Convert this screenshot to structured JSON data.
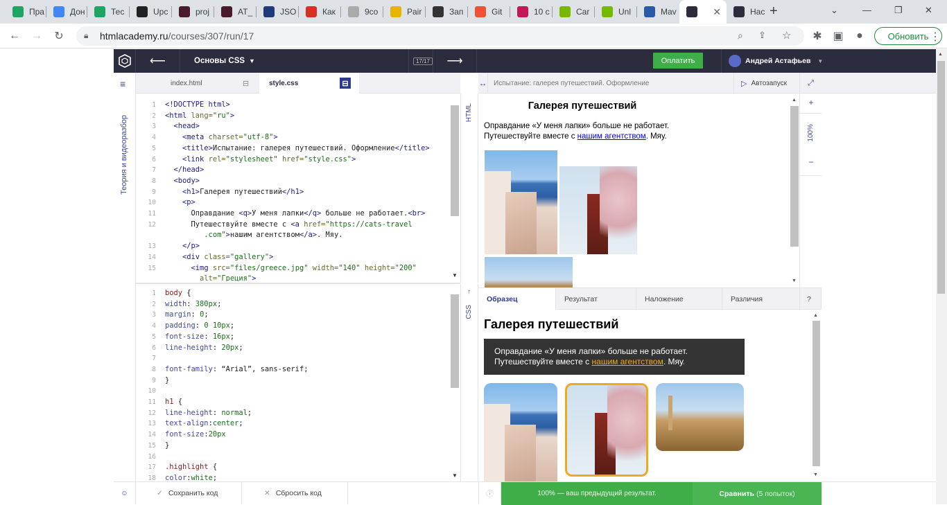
{
  "browser": {
    "tabs": [
      {
        "label": "Пра",
        "icon": "google-drive-icon"
      },
      {
        "label": "Дон",
        "icon": "google-docs-icon"
      },
      {
        "label": "Тес",
        "icon": "google-drive-icon"
      },
      {
        "label": "Upc",
        "icon": "upc-icon"
      },
      {
        "label": "proj",
        "icon": "yt-icon"
      },
      {
        "label": "AT_",
        "icon": "yt-icon"
      },
      {
        "label": "JSO",
        "icon": "json-icon"
      },
      {
        "label": "Как",
        "icon": "bookmark-icon"
      },
      {
        "label": "9co",
        "icon": "location-icon"
      },
      {
        "label": "Pair",
        "icon": "check-icon"
      },
      {
        "label": "Зап",
        "icon": "page-icon"
      },
      {
        "label": "Git",
        "icon": "git-icon"
      },
      {
        "label": "10 с",
        "icon": "v-icon"
      },
      {
        "label": "Car",
        "icon": "un-icon"
      },
      {
        "label": "Unl",
        "icon": "un-icon"
      },
      {
        "label": "Mav",
        "icon": "mvn-icon"
      },
      {
        "label": "",
        "icon": "htmlacademy-icon"
      },
      {
        "label": "Нас",
        "icon": "htmlacademy-icon"
      }
    ],
    "url_host": "htmlacademy.ru",
    "url_path": "/courses/307/run/17",
    "update_label": "Обновить"
  },
  "topbar": {
    "course": "Основы CSS",
    "progress": "17/17",
    "pay_label": "Оплатить",
    "user": "Андрей Астафьев"
  },
  "sidebar": {
    "label": "Теория и видеоразбор"
  },
  "editor": {
    "tab_html": "index.html",
    "tab_css": "style.css",
    "html_label": "HTML",
    "css_label": "CSS",
    "html_lines": [
      {
        "n": "1",
        "segs": [
          {
            "c": "tg",
            "t": "<!DOCTYPE html>"
          }
        ]
      },
      {
        "n": "2",
        "segs": [
          {
            "c": "tg",
            "t": "<html "
          },
          {
            "c": "at",
            "t": "lang="
          },
          {
            "c": "st",
            "t": "\"ru\""
          },
          {
            "c": "tg",
            "t": ">"
          }
        ]
      },
      {
        "n": "3",
        "segs": [
          {
            "c": "tx",
            "t": "  "
          },
          {
            "c": "tg",
            "t": "<head>"
          }
        ]
      },
      {
        "n": "4",
        "segs": [
          {
            "c": "tx",
            "t": "    "
          },
          {
            "c": "tg",
            "t": "<meta "
          },
          {
            "c": "at",
            "t": "charset="
          },
          {
            "c": "st",
            "t": "\"utf-8\""
          },
          {
            "c": "tg",
            "t": ">"
          }
        ]
      },
      {
        "n": "5",
        "segs": [
          {
            "c": "tx",
            "t": "    "
          },
          {
            "c": "tg",
            "t": "<title>"
          },
          {
            "c": "tx",
            "t": "Испытание: галерея путешествий. Оформление"
          },
          {
            "c": "tg",
            "t": "</title>"
          }
        ]
      },
      {
        "n": "6",
        "segs": [
          {
            "c": "tx",
            "t": "    "
          },
          {
            "c": "tg",
            "t": "<link "
          },
          {
            "c": "at",
            "t": "rel="
          },
          {
            "c": "st",
            "t": "\"stylesheet\" "
          },
          {
            "c": "at",
            "t": "href="
          },
          {
            "c": "st",
            "t": "\"style.css\""
          },
          {
            "c": "tg",
            "t": ">"
          }
        ]
      },
      {
        "n": "7",
        "segs": [
          {
            "c": "tx",
            "t": "  "
          },
          {
            "c": "tg",
            "t": "</head>"
          }
        ]
      },
      {
        "n": "8",
        "segs": [
          {
            "c": "tx",
            "t": "  "
          },
          {
            "c": "tg",
            "t": "<body>"
          }
        ]
      },
      {
        "n": "9",
        "segs": [
          {
            "c": "tx",
            "t": "    "
          },
          {
            "c": "tg",
            "t": "<h1>"
          },
          {
            "c": "tx",
            "t": "Галерея путешествий"
          },
          {
            "c": "tg",
            "t": "</h1>"
          }
        ]
      },
      {
        "n": "10",
        "segs": [
          {
            "c": "tx",
            "t": "    "
          },
          {
            "c": "tg",
            "t": "<p>"
          }
        ]
      },
      {
        "n": "11",
        "segs": [
          {
            "c": "tx",
            "t": "      Оправдание "
          },
          {
            "c": "tg",
            "t": "<q>"
          },
          {
            "c": "tx",
            "t": "У меня лапки"
          },
          {
            "c": "tg",
            "t": "</q>"
          },
          {
            "c": "tx",
            "t": " больше не работает."
          },
          {
            "c": "tg",
            "t": "<br>"
          }
        ]
      },
      {
        "n": "12",
        "segs": [
          {
            "c": "tx",
            "t": "      Путешествуйте вместе с "
          },
          {
            "c": "tg",
            "t": "<a "
          },
          {
            "c": "at",
            "t": "href="
          },
          {
            "c": "st",
            "t": "\"https://cats-travel"
          }
        ]
      },
      {
        "n": "",
        "segs": [
          {
            "c": "st",
            "t": "         .com\""
          },
          {
            "c": "tg",
            "t": ">"
          },
          {
            "c": "tx",
            "t": "нашим агентством"
          },
          {
            "c": "tg",
            "t": "</a>"
          },
          {
            "c": "tx",
            "t": ". Мяу."
          }
        ]
      },
      {
        "n": "13",
        "segs": [
          {
            "c": "tx",
            "t": "    "
          },
          {
            "c": "tg",
            "t": "</p>"
          }
        ]
      },
      {
        "n": "14",
        "segs": [
          {
            "c": "tx",
            "t": "    "
          },
          {
            "c": "tg",
            "t": "<div "
          },
          {
            "c": "at",
            "t": "class="
          },
          {
            "c": "st",
            "t": "\"gallery\""
          },
          {
            "c": "tg",
            "t": ">"
          }
        ]
      },
      {
        "n": "15",
        "segs": [
          {
            "c": "tx",
            "t": "      "
          },
          {
            "c": "tg",
            "t": "<img "
          },
          {
            "c": "at",
            "t": "src="
          },
          {
            "c": "st",
            "t": "\"files/greece.jpg\" "
          },
          {
            "c": "at",
            "t": "width="
          },
          {
            "c": "st",
            "t": "\"140\" "
          },
          {
            "c": "at",
            "t": "height="
          },
          {
            "c": "st",
            "t": "\"200\""
          }
        ]
      },
      {
        "n": "",
        "segs": [
          {
            "c": "tx",
            "t": "        "
          },
          {
            "c": "at",
            "t": "alt="
          },
          {
            "c": "st",
            "t": "\"Греция\""
          },
          {
            "c": "tg",
            "t": ">"
          }
        ]
      }
    ],
    "css_lines": [
      {
        "n": "1",
        "segs": [
          {
            "c": "sel",
            "t": "body"
          },
          {
            "c": "tx",
            "t": " {"
          }
        ]
      },
      {
        "n": "2",
        "segs": [
          {
            "c": "pr",
            "t": "width"
          },
          {
            "c": "tx",
            "t": ": "
          },
          {
            "c": "st",
            "t": "380px"
          },
          {
            "c": "tx",
            "t": ";"
          }
        ]
      },
      {
        "n": "3",
        "segs": [
          {
            "c": "pr",
            "t": "margin"
          },
          {
            "c": "tx",
            "t": ": "
          },
          {
            "c": "st",
            "t": "0"
          },
          {
            "c": "tx",
            "t": ";"
          }
        ]
      },
      {
        "n": "4",
        "segs": [
          {
            "c": "pr",
            "t": "padding"
          },
          {
            "c": "tx",
            "t": ": "
          },
          {
            "c": "st",
            "t": "0 10px"
          },
          {
            "c": "tx",
            "t": ";"
          }
        ]
      },
      {
        "n": "5",
        "segs": [
          {
            "c": "pr",
            "t": "font-size"
          },
          {
            "c": "tx",
            "t": ": "
          },
          {
            "c": "st",
            "t": "16px"
          },
          {
            "c": "tx",
            "t": ";"
          }
        ]
      },
      {
        "n": "6",
        "segs": [
          {
            "c": "pr",
            "t": "line-height"
          },
          {
            "c": "tx",
            "t": ": "
          },
          {
            "c": "st",
            "t": "20px"
          },
          {
            "c": "tx",
            "t": ";"
          }
        ]
      },
      {
        "n": "7",
        "segs": []
      },
      {
        "n": "8",
        "segs": [
          {
            "c": "pr",
            "t": "font-family"
          },
          {
            "c": "tx",
            "t": ": “Arial”, sans-serif;"
          }
        ]
      },
      {
        "n": "9",
        "segs": [
          {
            "c": "tx",
            "t": "}"
          }
        ]
      },
      {
        "n": "10",
        "segs": []
      },
      {
        "n": "11",
        "segs": [
          {
            "c": "sel",
            "t": "h1"
          },
          {
            "c": "tx",
            "t": " {"
          }
        ]
      },
      {
        "n": "12",
        "segs": [
          {
            "c": "pr",
            "t": "line-height"
          },
          {
            "c": "tx",
            "t": ": "
          },
          {
            "c": "st",
            "t": "normal"
          },
          {
            "c": "tx",
            "t": ";"
          }
        ]
      },
      {
        "n": "13",
        "segs": [
          {
            "c": "pr",
            "t": "text-align"
          },
          {
            "c": "tx",
            "t": ":"
          },
          {
            "c": "st",
            "t": "center"
          },
          {
            "c": "tx",
            "t": ";"
          }
        ]
      },
      {
        "n": "14",
        "segs": [
          {
            "c": "pr",
            "t": "font-size"
          },
          {
            "c": "tx",
            "t": ":"
          },
          {
            "c": "st",
            "t": "20px"
          }
        ]
      },
      {
        "n": "15",
        "segs": [
          {
            "c": "tx",
            "t": "}"
          }
        ]
      },
      {
        "n": "16",
        "segs": []
      },
      {
        "n": "17",
        "segs": [
          {
            "c": "sel",
            "t": ".highlight"
          },
          {
            "c": "tx",
            "t": " {"
          }
        ]
      },
      {
        "n": "18",
        "segs": [
          {
            "c": "pr",
            "t": "color"
          },
          {
            "c": "tx",
            "t": ":"
          },
          {
            "c": "st",
            "t": "white"
          },
          {
            "c": "tx",
            "t": ";"
          }
        ]
      }
    ]
  },
  "preview": {
    "title": "Испытание: галерея путешествий. Оформление",
    "autorun": "Автозапуск",
    "zoom": "100%",
    "zoom_plus": "+",
    "zoom_minus": "−",
    "heading": "Галерея путешествий",
    "p_line1": "Оправдание «У меня лапки» больше не работает.",
    "p_line2_pre": "Путешествуйте вместе с ",
    "p_link": "нашим агентством",
    "p_line2_post": ". Мяу.",
    "tabs": [
      "Образец",
      "Результат",
      "Наложение",
      "Различия",
      "?"
    ]
  },
  "bottom": {
    "save": "Сохранить код",
    "reset": "Сбросить код",
    "result": "100% — ваш предыдущий результат.",
    "compare": "Сравнить",
    "attempts": "(5 попыток)"
  },
  "colors": {
    "accent_green": "#3fae49",
    "topbar": "#2b2c3e",
    "highlight_border": "#f0a81c"
  }
}
